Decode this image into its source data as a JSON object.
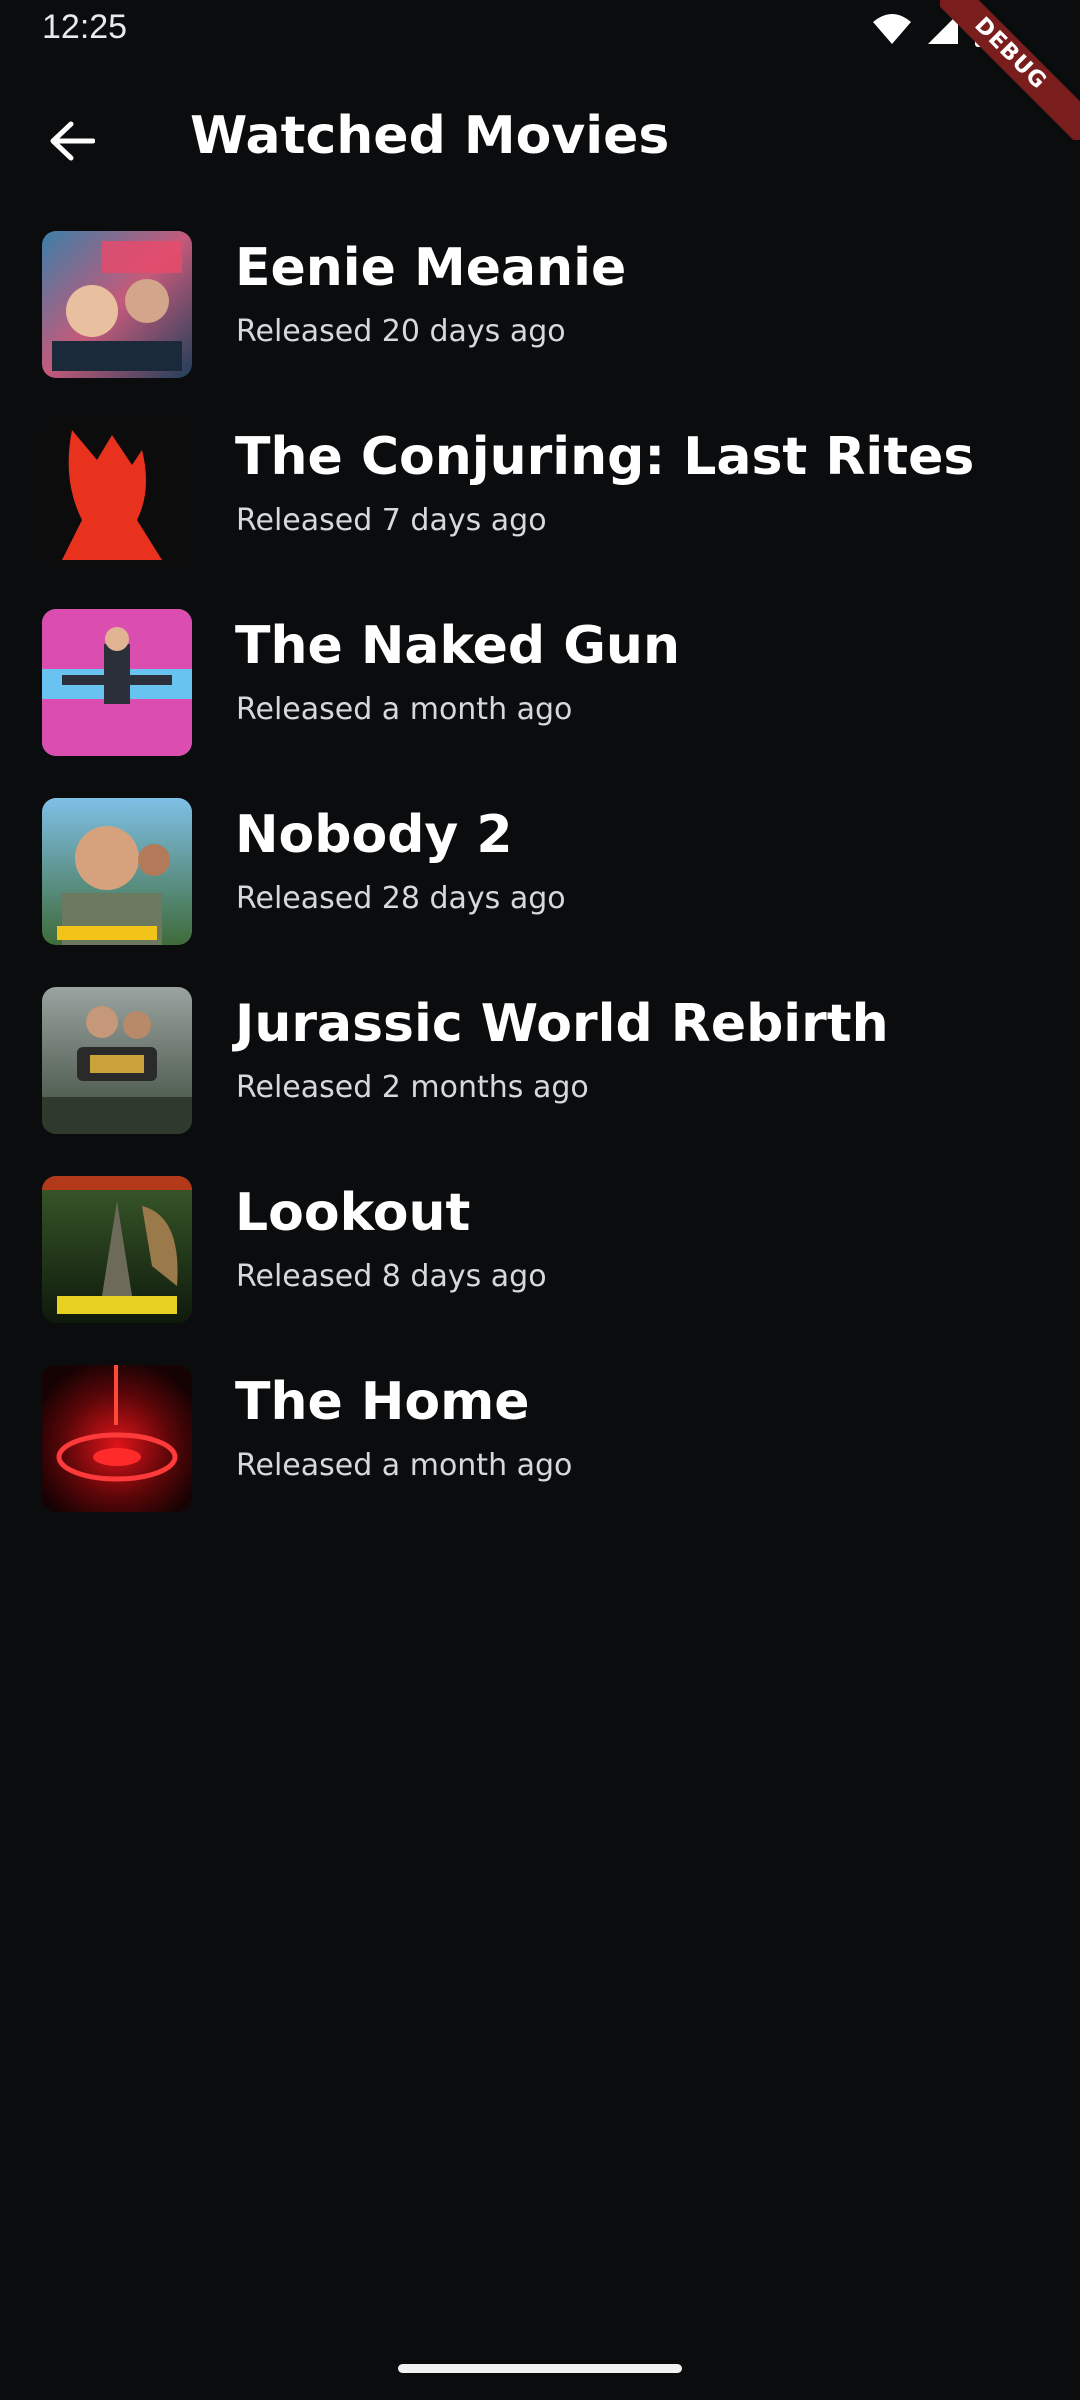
{
  "status_bar": {
    "time": "12:25",
    "icons": [
      "wifi-icon",
      "cellular-signal-icon",
      "battery-icon"
    ]
  },
  "debug_banner": "DEBUG",
  "app_bar": {
    "back_icon": "arrow-left-icon",
    "title": "Watched Movies"
  },
  "movies": [
    {
      "title": "Eenie Meanie",
      "subtitle": "Released 20 days ago"
    },
    {
      "title": "The Conjuring: Last Rites",
      "subtitle": "Released 7 days ago"
    },
    {
      "title": "The Naked Gun",
      "subtitle": "Released a month ago"
    },
    {
      "title": "Nobody 2",
      "subtitle": "Released 28 days ago"
    },
    {
      "title": "Jurassic World Rebirth",
      "subtitle": "Released 2 months ago"
    },
    {
      "title": "Lookout",
      "subtitle": "Released 8 days ago"
    },
    {
      "title": "The Home",
      "subtitle": "Released a month ago"
    }
  ],
  "colors": {
    "background": "#0b0c0e",
    "text_primary": "#ffffff",
    "text_secondary": "#d7d8da",
    "debug_ribbon": "#7a1d1d"
  }
}
